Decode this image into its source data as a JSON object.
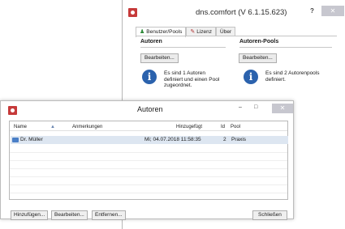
{
  "main_window": {
    "title": "dns.comfort (V 6.1.15.623)",
    "help_label": "?",
    "close_label": "✕",
    "tabs": [
      {
        "label": "Benutzer/Pools",
        "icon": "users-icon",
        "active": true
      },
      {
        "label": "Lizenz",
        "icon": "license-icon",
        "active": false
      },
      {
        "label": "Über",
        "icon": "",
        "active": false
      }
    ],
    "autoren": {
      "heading": "Autoren",
      "edit_label": "Bearbeiten...",
      "info": "Es sind 1 Autoren\ndefiniert und einen Pool\nzugeordnet."
    },
    "pools": {
      "heading": "Autoren-Pools",
      "edit_label": "Bearbeiten...",
      "info": "Es sind 2 Autorenpools\ndefiniert."
    }
  },
  "dialog": {
    "title": "Autoren",
    "minimize_label": "–",
    "maximize_label": "□",
    "close_label": "✕",
    "columns": [
      "Name",
      "Anmerkungen",
      "Hinzugefügt",
      "Id",
      "Pool"
    ],
    "rows": [
      {
        "name": "Dr. Müller",
        "notes": "",
        "added": "Mi; 04.07.2018 11:58:35",
        "id": "2",
        "pool": "Praxis"
      }
    ],
    "buttons": {
      "add": "Hinzufügen...",
      "edit": "Bearbeiten...",
      "remove": "Entfernen...",
      "close": "Schließen"
    }
  },
  "colors": {
    "accent": "#2b62ad",
    "selection": "#dde6f1",
    "app_icon": "#c63a3a"
  }
}
